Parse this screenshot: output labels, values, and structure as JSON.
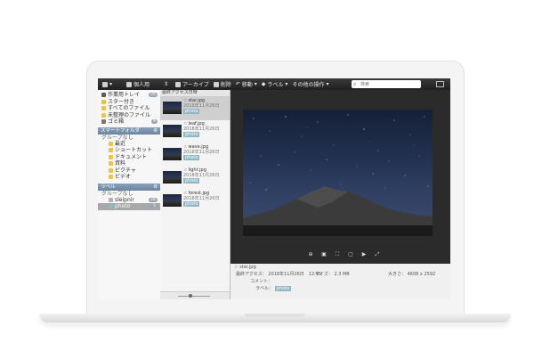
{
  "toolbar": {
    "personal": "個人用",
    "archive": "アーカイブ",
    "delete": "削除",
    "move": "移動",
    "label": "ラベル",
    "other": "その他の操作",
    "search_placeholder": "検索"
  },
  "sidebar": {
    "top_items": [
      {
        "label": "作業用トレイ",
        "count": "26"
      },
      {
        "label": "スター付き",
        "count": ""
      },
      {
        "label": "すべてのファイル",
        "count": ""
      },
      {
        "label": "未整理のファイル",
        "count": ""
      },
      {
        "label": "ゴミ箱",
        "count": "9"
      }
    ],
    "smart_folder_header": "スマートフォルダ",
    "group_none_1": "グループなし",
    "smart_items": [
      "最近",
      "ショートカット",
      "ドキュメント",
      "資料",
      "ピクチャ",
      "ビデオ"
    ],
    "label_header": "ラベル",
    "group_none_2": "グループなし",
    "label_items": [
      {
        "label": "sleipnir",
        "count": "26"
      },
      {
        "label": "photo",
        "count": "5"
      }
    ]
  },
  "thumbs": {
    "header": "最終アクセス日時",
    "items": [
      {
        "name": "star.jpg",
        "date": "2018年11月26日",
        "tag": "photo"
      },
      {
        "name": "leaf.jpg",
        "date": "2018年11月26日",
        "tag": "photo"
      },
      {
        "name": "wave.jpg",
        "date": "2018年11月26日",
        "tag": "photo"
      },
      {
        "name": "light.jpg",
        "date": "2018年11月26日",
        "tag": "photo"
      },
      {
        "name": "forest.jpg",
        "date": "2018年11月26日",
        "tag": "photo"
      }
    ]
  },
  "details": {
    "filename": "star.jpg",
    "access_label": "最終アクセス：",
    "access_value": "2018年11月26日　12:15",
    "size_label": "サイズ：",
    "size_value": "2.3 MB",
    "dims_label": "大きさ：",
    "dims_value": "4608 x 2592",
    "comment_label": "コメント：",
    "label_label": "ラベル：",
    "label_value": "photo"
  },
  "colors": {
    "toolbar": "#2a2a2a",
    "sidebar_header": "#7a90aa",
    "tag": "#8fb7c4",
    "selected": "#a8a8a8"
  }
}
